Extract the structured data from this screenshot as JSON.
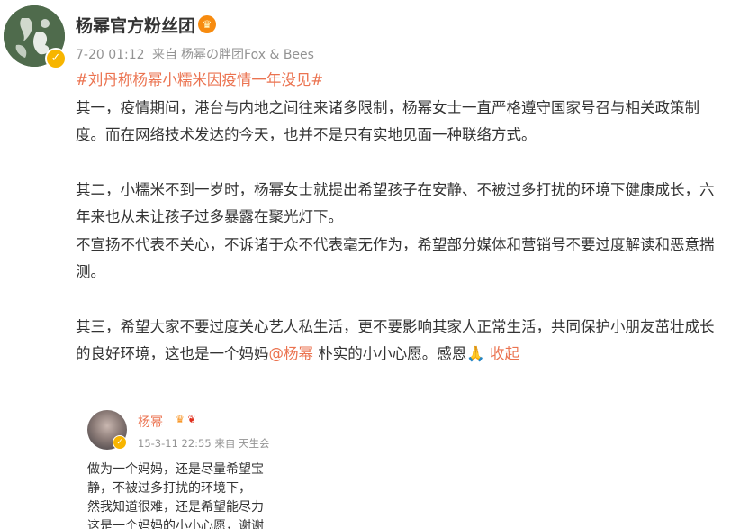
{
  "post": {
    "username": "杨幂官方粉丝团",
    "badge_icon": "crown-badge-icon",
    "timestamp": "7-20 01:12",
    "source_prefix": "来自",
    "source": "杨幂の胖团Fox & Bees",
    "hashtag": "#刘丹称杨幂小糯米因疫情一年没见#",
    "paragraphs": [
      "其一，疫情期间，港台与内地之间往来诸多限制，杨幂女士一直严格遵守国家号召与相关政策制度。而在网络技术发达的今天，也并不是只有实地见面一种联络方式。",
      "其二，小糯米不到一岁时，杨幂女士就提出希望孩子在安静、不被过多打扰的环境下健康成长，六年来也从未让孩子过多暴露在聚光灯下。",
      "不宣扬不代表不关心，不诉诸于众不代表毫无作为，希望部分媒体和营销号不要过度解读和恶意揣测。",
      "其三，希望大家不要过度关心艺人私生活，更不要影响其家人正常生活，共同保护小朋友茁壮成长的良好环境，这也是一个妈妈"
    ],
    "mention": "@杨幂",
    "closing_text": " 朴实的小小心愿。感恩",
    "emoji": "🙏",
    "collapse_label": " 收起"
  },
  "quote": {
    "name": "杨幂",
    "timestamp": "15-3-11 22:55",
    "source": "来自 天生会",
    "lines": [
      "做为一个妈妈，还是尽量希望宝",
      "静，不被过多打扰的环境下，",
      "然我知道很难，还是希望能尽力",
      "这是一个妈妈的小小心愿，谢谢"
    ]
  },
  "colors": {
    "accent": "#eb7350",
    "text": "#333333",
    "meta": "#939393",
    "verified": "#f7b500"
  }
}
